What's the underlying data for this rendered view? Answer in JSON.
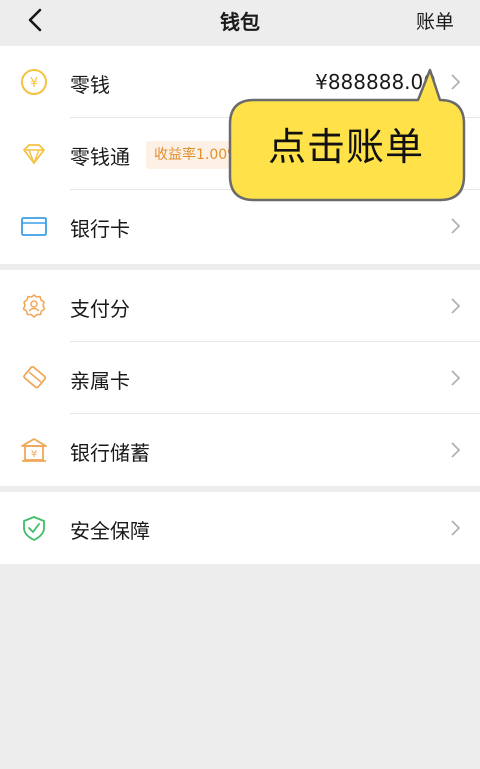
{
  "header": {
    "title": "钱包",
    "bill_label": "账单"
  },
  "groups": [
    {
      "items": [
        {
          "label": "零钱",
          "icon": "yuan-coin-icon",
          "amount": "¥888888.00"
        },
        {
          "label": "零钱通",
          "icon": "diamond-icon",
          "badge": "收益率1.00%"
        },
        {
          "label": "银行卡",
          "icon": "bank-card-icon"
        }
      ]
    },
    {
      "items": [
        {
          "label": "支付分",
          "icon": "pay-score-icon"
        },
        {
          "label": "亲属卡",
          "icon": "family-card-icon"
        },
        {
          "label": "银行储蓄",
          "icon": "bank-deposit-icon"
        }
      ]
    },
    {
      "items": [
        {
          "label": "安全保障",
          "icon": "security-shield-icon"
        }
      ]
    }
  ],
  "callout": {
    "text": "点击账单"
  },
  "colors": {
    "background": "#ededed",
    "callout_fill": "#ffe24a",
    "icon_orange": "#f0a85b",
    "icon_yellow": "#f5c242",
    "icon_blue": "#3a9fe8",
    "icon_green": "#3fbe6b"
  }
}
